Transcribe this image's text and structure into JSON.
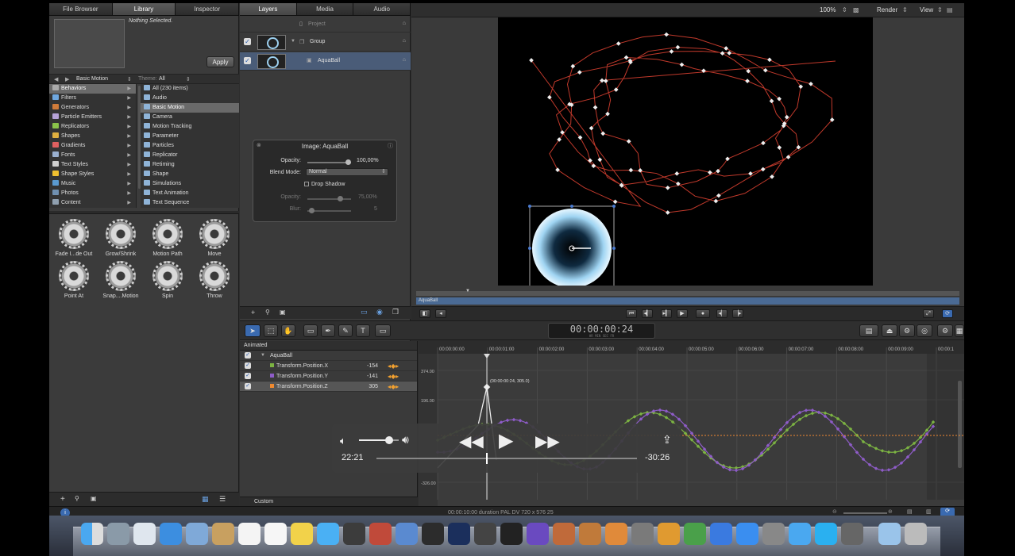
{
  "left_panel": {
    "tabs": [
      "File Browser",
      "Library",
      "Inspector"
    ],
    "status": "Nothing Selected.",
    "apply_label": "Apply",
    "path": "Basic Motion",
    "theme_label": "Theme:",
    "theme_value": "All",
    "categories": [
      {
        "label": "Behaviors",
        "color": "#aaaaaa"
      },
      {
        "label": "Filters",
        "color": "#6fa8e0"
      },
      {
        "label": "Generators",
        "color": "#d07b3a"
      },
      {
        "label": "Particle Emitters",
        "color": "#b6a2d8"
      },
      {
        "label": "Replicators",
        "color": "#8bc34a"
      },
      {
        "label": "Shapes",
        "color": "#e0b040"
      },
      {
        "label": "Gradients",
        "color": "#e06060"
      },
      {
        "label": "Fonts",
        "color": "#9ab0d0"
      },
      {
        "label": "Text Styles",
        "color": "#d0d0d0"
      },
      {
        "label": "Shape Styles",
        "color": "#f0c030"
      },
      {
        "label": "Music",
        "color": "#5a9ad0"
      },
      {
        "label": "Photos",
        "color": "#7090b0"
      },
      {
        "label": "Content",
        "color": "#90a0b0"
      }
    ],
    "subcategories": [
      "All (230 items)",
      "Audio",
      "Basic Motion",
      "Camera",
      "Motion Tracking",
      "Parameter",
      "Particles",
      "Replicator",
      "Retiming",
      "Shape",
      "Simulations",
      "Text Animation",
      "Text Sequence"
    ],
    "library_items": [
      "Fade I...de Out",
      "Grow/Shrink",
      "Motion Path",
      "Move",
      "Point At",
      "Snap....Motion",
      "Spin",
      "Throw"
    ]
  },
  "layers_panel": {
    "tabs": [
      "Layers",
      "Media",
      "Audio"
    ],
    "project_label": "Project",
    "group_label": "Group",
    "layer_label": "AquaBall",
    "hud": {
      "title": "Image: AquaBall",
      "opacity_label": "Opacity:",
      "opacity_value": "100,00%",
      "blend_label": "Blend Mode:",
      "blend_value": "Normal",
      "shadow_label": "Drop Shadow",
      "shadow_opacity_label": "Opacity:",
      "shadow_opacity_value": "75,00%",
      "blur_label": "Blur:",
      "blur_value": "5"
    }
  },
  "canvas": {
    "zoom": "100%",
    "render_label": "Render",
    "view_label": "View",
    "mini_label": "AquaBall"
  },
  "timecode": {
    "value": "00:00:00:24",
    "units": "HR   MIN   SEC   FR"
  },
  "timeline_list": {
    "header": "Animated",
    "object": "AquaBall",
    "params": [
      {
        "name": "Transform.Position.X",
        "value": "-154",
        "color": "#7cb342"
      },
      {
        "name": "Transform.Position.Y",
        "value": "-141",
        "color": "#8e5cc8"
      },
      {
        "name": "Transform.Position.Z",
        "value": "305",
        "color": "#f08a30"
      }
    ],
    "footer": "Custom"
  },
  "curve_editor": {
    "ruler": [
      "00:00:00:00",
      "00:00:01:00",
      "00:00:02:00",
      "00:00:03:00",
      "00:00:04:00",
      "00:00:05:00",
      "00:00:06:00",
      "00:00:07:00",
      "00:00:08:00",
      "00:00:09:00",
      "00:00:1"
    ],
    "y_labels": [
      "374.00",
      "196.00",
      "-326.00"
    ],
    "keyframe_label": "(00:00:00:24, 305.0)"
  },
  "status_bar": "00:00:10:00 duration PAL DV 720 x 576 25",
  "video_player": {
    "elapsed": "22:21",
    "remaining": "-30:26",
    "progress": 0.42,
    "volume": 0.75
  }
}
